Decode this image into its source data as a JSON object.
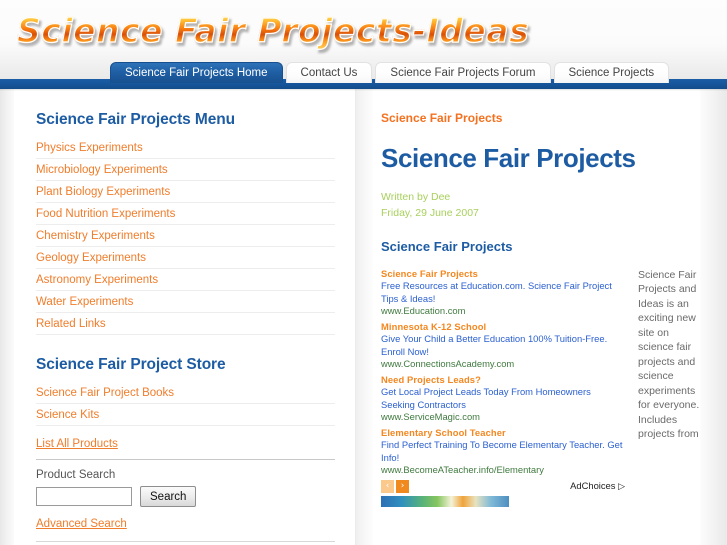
{
  "site": {
    "logo_text": "Science Fair Projects-Ideas"
  },
  "nav": {
    "tabs": [
      {
        "label": "Science Fair Projects Home",
        "active": true
      },
      {
        "label": "Contact Us",
        "active": false
      },
      {
        "label": "Science Fair Projects Forum",
        "active": false
      },
      {
        "label": "Science Projects",
        "active": false
      }
    ]
  },
  "sidebar": {
    "menu_heading": "Science Fair Projects Menu",
    "menu_items": [
      {
        "label": "Physics Experiments"
      },
      {
        "label": "Microbiology Experiments"
      },
      {
        "label": "Plant Biology Experiments"
      },
      {
        "label": "Food Nutrition Experiments"
      },
      {
        "label": "Chemistry Experiments"
      },
      {
        "label": "Geology Experiments"
      },
      {
        "label": "Astronomy Experiments"
      },
      {
        "label": "Water Experiments"
      },
      {
        "label": "Related Links"
      }
    ],
    "store_heading": "Science Fair Project Store",
    "store_items": [
      {
        "label": "Science Fair Project Books"
      },
      {
        "label": "Science Kits"
      }
    ],
    "list_all_label": "List All Products",
    "product_search_label": "Product Search",
    "search_value": "",
    "search_placeholder": "",
    "search_button_label": "Search",
    "advanced_search_label": "Advanced Search"
  },
  "main": {
    "breadcrumb": "Science Fair Projects",
    "article_title": "Science Fair Projects",
    "written_by": "Written by Dee",
    "date": "Friday, 29 June 2007",
    "subheading": "Science Fair Projects",
    "sidenote": "Science Fair Projects and Ideas is an exciting new site on science fair projects and science experiments for everyone. Includes projects from"
  },
  "ads": {
    "items": [
      {
        "title": "Science Fair Projects",
        "desc": "Free Resources at Education.com. Science Fair Project Tips & Ideas!",
        "url": "www.Education.com"
      },
      {
        "title": "Minnesota K-12 School",
        "desc": "Give Your Child a Better Education 100% Tuition-Free. Enroll Now!",
        "url": "www.ConnectionsAcademy.com"
      },
      {
        "title": "Need Projects Leads?",
        "desc": "Get Local Project Leads Today From Homeowners Seeking Contractors",
        "url": "www.ServiceMagic.com"
      },
      {
        "title": "Elementary School Teacher",
        "desc": "Find Perfect Training To Become Elementary Teacher. Get Info!",
        "url": "www.BecomeATeacher.info/Elementary"
      }
    ],
    "prev_label": "‹",
    "next_label": "›",
    "adchoices_label": "AdChoices",
    "adchoices_glyph": "▷"
  },
  "colors": {
    "brand_blue": "#1d5ca3",
    "link_orange": "#f07d2b",
    "ad_title_orange": "#f4871f",
    "ad_desc_blue": "#2a5fd0",
    "ad_url_green": "#3f7a3f",
    "meta_green": "#a8d05c",
    "bar_blue": "#17559a"
  }
}
